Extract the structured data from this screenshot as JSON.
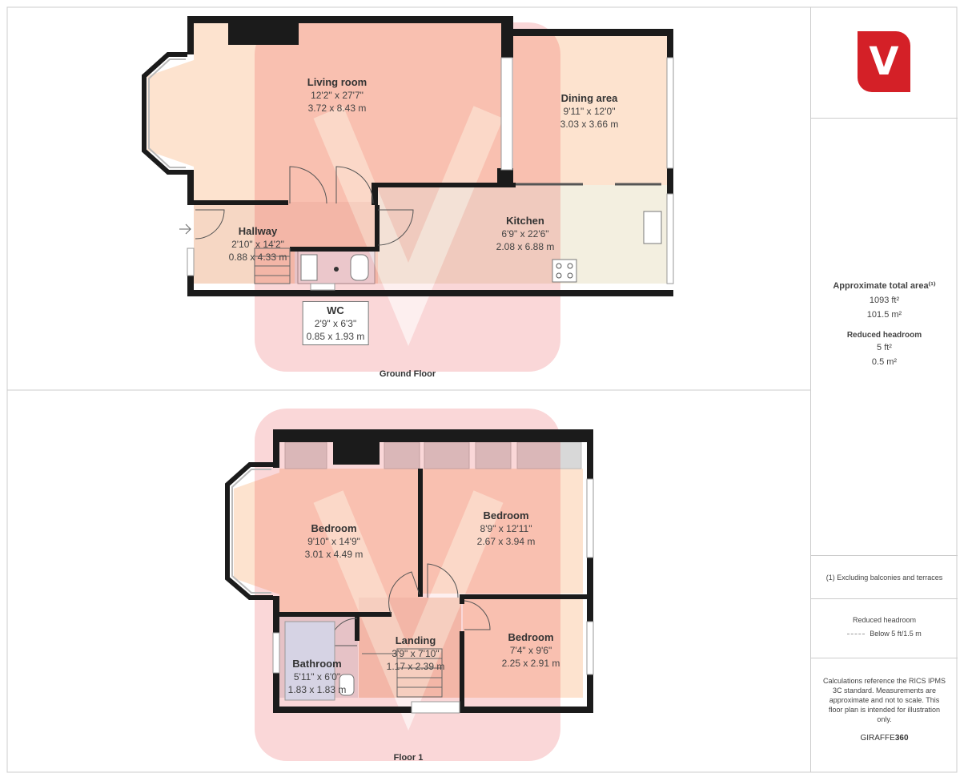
{
  "brand": {
    "logo_letter": "V",
    "accent": "#d42027"
  },
  "floors": [
    {
      "name": "Ground Floor",
      "rooms": [
        {
          "name": "Living room",
          "imperial": "12'2\" x 27'7\"",
          "metric": "3.72 x 8.43 m"
        },
        {
          "name": "Dining area",
          "imperial": "9'11\" x 12'0\"",
          "metric": "3.03 x 3.66 m"
        },
        {
          "name": "Hallway",
          "imperial": "2'10\" x 14'2\"",
          "metric": "0.88 x 4.33 m"
        },
        {
          "name": "Kitchen",
          "imperial": "6'9\" x 22'6\"",
          "metric": "2.08 x 6.88 m"
        },
        {
          "name": "WC",
          "imperial": "2'9\" x 6'3\"",
          "metric": "0.85 x 1.93 m"
        }
      ]
    },
    {
      "name": "Floor 1",
      "rooms": [
        {
          "name": "Bedroom",
          "imperial": "9'10\" x 14'9\"",
          "metric": "3.01 x 4.49 m"
        },
        {
          "name": "Bedroom",
          "imperial": "8'9\" x 12'11\"",
          "metric": "2.67 x 3.94 m"
        },
        {
          "name": "Bedroom",
          "imperial": "7'4\" x 9'6\"",
          "metric": "2.25 x 2.91 m"
        },
        {
          "name": "Landing",
          "imperial": "3'9\" x 7'10\"",
          "metric": "1.17 x 2.39 m"
        },
        {
          "name": "Bathroom",
          "imperial": "5'11\" x 6'0\"",
          "metric": "1.83 x 1.83 m"
        }
      ]
    }
  ],
  "summary": {
    "total_title": "Approximate total area⁽¹⁾",
    "total_ft": "1093 ft²",
    "total_m": "101.5 m²",
    "reduced_title": "Reduced headroom",
    "reduced_ft": "5 ft²",
    "reduced_m": "0.5 m²"
  },
  "footnote": "(1) Excluding balconies and terraces",
  "legend": {
    "title": "Reduced headroom",
    "item": "Below 5 ft/1.5 m"
  },
  "disclaimer": "Calculations reference the RICS IPMS 3C standard. Measurements are approximate and not to scale. This floor plan is intended for illustration only.",
  "credit": {
    "prefix": "GIRAFFE",
    "suffix": "360"
  },
  "colors": {
    "wall": "#1b1b1b",
    "floor_fill": "#fde3cf",
    "hall_fill": "#f6d7c4",
    "kitchen_fill": "#f3efe0",
    "bath_fill": "#e6e6ea",
    "watermark": "#e8262b"
  }
}
